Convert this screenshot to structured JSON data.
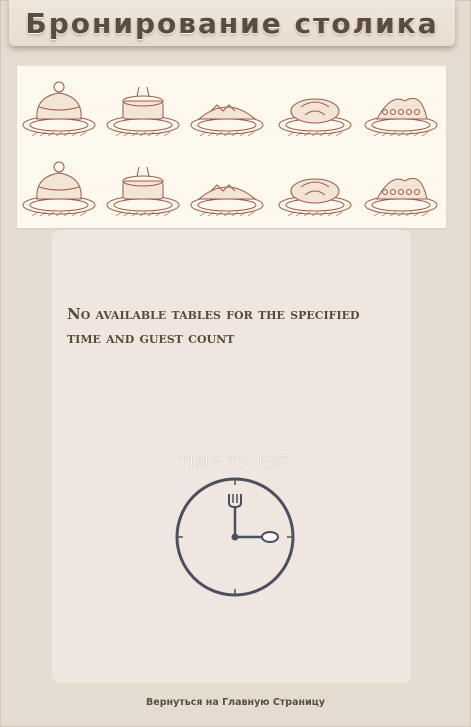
{
  "header": {
    "title": "Бронирование столика"
  },
  "banner": {
    "icon": "sketched-dishes-illustration",
    "ink_color": "#9c5a46"
  },
  "main": {
    "message": "No available tables for the specified time and guest count",
    "illustration": {
      "caption": "TIME TO EAT",
      "icon": "clock-fork-spoon-icon"
    }
  },
  "footer": {
    "back_link": "Вернуться на Главную Страницу"
  },
  "colors": {
    "page_bg": "#e5dcd1",
    "card_bg": "#efe7df",
    "text": "#5b4d3e",
    "clock_stroke": "#4a5060"
  }
}
